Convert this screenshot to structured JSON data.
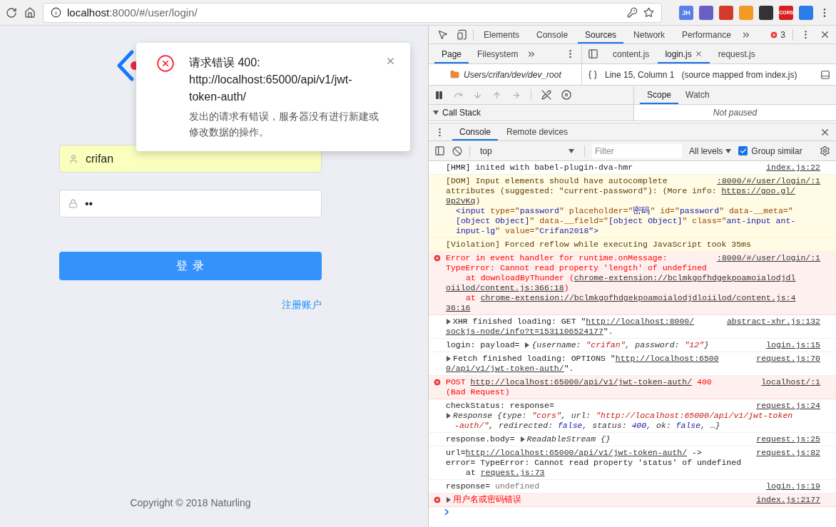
{
  "browser": {
    "address": {
      "host": "localhost",
      "path": ":8000/#/user/login/"
    },
    "extensions": [
      {
        "label": "JH",
        "color": "#5a7fe8"
      },
      {
        "color": "#6b5fc4"
      },
      {
        "color": "#d23a2c"
      },
      {
        "color": "#f39a26"
      },
      {
        "color": "#333333"
      },
      {
        "label": "CORS",
        "color": "#d81e1e"
      },
      {
        "color": "#2b7de9"
      }
    ]
  },
  "login_page": {
    "username": {
      "value": "crifan",
      "autofilled": true
    },
    "password": {
      "value": "••",
      "autofilled": false
    },
    "submit": "登 录",
    "register_link": "注册账户",
    "copyright": "Copyright © 2018 Naturling"
  },
  "notification": {
    "kind": "error",
    "title": "请求错误 400: http://localhost:65000/api/v1/jwt-token-auth/",
    "description": "发出的请求有错误，服务器没有进行新建或修改数据的操作。"
  },
  "devtools": {
    "tabs": [
      {
        "label": "Elements",
        "selected": false
      },
      {
        "label": "Console",
        "selected": false
      },
      {
        "label": "Sources",
        "selected": true
      },
      {
        "label": "Network",
        "selected": false
      },
      {
        "label": "Performance",
        "selected": false
      }
    ],
    "error_count": "3",
    "navigator": {
      "tabs": [
        {
          "label": "Page",
          "selected": true
        },
        {
          "label": "Filesystem",
          "selected": false
        }
      ],
      "tree_item": "Users/crifan/dev/dev_root"
    },
    "editor_tabs": [
      {
        "label": "content.js",
        "selected": false,
        "closable": false
      },
      {
        "label": "login.js",
        "selected": true,
        "closable": true
      },
      {
        "label": "request.js",
        "selected": false,
        "closable": false
      }
    ],
    "status": {
      "position": "Line 15, Column 1",
      "source_map": "(source mapped from index.js)"
    },
    "call_stack": {
      "label": "Call Stack",
      "expanded": true
    },
    "sidebar_tabs": [
      {
        "label": "Scope",
        "selected": true
      },
      {
        "label": "Watch",
        "selected": false
      }
    ],
    "sidebar_message": "Not paused",
    "drawer_tabs": [
      {
        "label": "Console",
        "selected": true
      },
      {
        "label": "Remote devices",
        "selected": false
      }
    ],
    "console_toolbar": {
      "context": "top",
      "filter_placeholder": "Filter",
      "levels": "All levels",
      "group_similar": {
        "label": "Group similar",
        "checked": true
      }
    },
    "messages": [
      {
        "kind": "info",
        "source": "index.js:22",
        "lines": [
          {
            "kind": "plain",
            "segs": [
              {
                "kind": "plain",
                "text": "[HMR] inited with babel-plugin-dva-hmr"
              }
            ]
          }
        ]
      },
      {
        "kind": "warning",
        "source": ":8000/#/user/login/:1",
        "lines": [
          {
            "kind": "plain",
            "segs": [
              {
                "kind": "plain",
                "text": "[DOM] Input elements should have autocomplete"
              }
            ]
          },
          {
            "kind": "plain",
            "segs": [
              {
                "kind": "plain",
                "text": "attributes (suggested: \"current-password\"): (More info: "
              },
              {
                "kind": "link",
                "text": "https://goo.gl/"
              }
            ]
          },
          {
            "kind": "plain",
            "segs": [
              {
                "kind": "link",
                "text": "9p2vKq"
              },
              {
                "kind": "plain",
                "text": ")"
              }
            ]
          },
          {
            "kind": "node",
            "segs": [
              {
                "kind": "tag",
                "text": "<input "
              },
              {
                "kind": "attr",
                "text": "type=\""
              },
              {
                "kind": "value",
                "text": "password"
              },
              {
                "kind": "attr",
                "text": "\" placeholder=\""
              },
              {
                "kind": "value",
                "text": "密码"
              },
              {
                "kind": "attr",
                "text": "\" id=\""
              },
              {
                "kind": "value",
                "text": "password"
              },
              {
                "kind": "attr",
                "text": "\" data-__meta=\""
              }
            ]
          },
          {
            "kind": "node",
            "segs": [
              {
                "kind": "value",
                "text": "[object Object]"
              },
              {
                "kind": "attr",
                "text": "\" data-__field=\""
              },
              {
                "kind": "value",
                "text": "[object Object]"
              },
              {
                "kind": "attr",
                "text": "\" class=\""
              },
              {
                "kind": "value",
                "text": "ant-input ant-"
              }
            ]
          },
          {
            "kind": "node",
            "segs": [
              {
                "kind": "value",
                "text": "input-lg"
              },
              {
                "kind": "attr",
                "text": "\" value=\""
              },
              {
                "kind": "value",
                "text": "Crifan2018"
              },
              {
                "kind": "tag",
                "text": "\">"
              }
            ]
          }
        ]
      },
      {
        "kind": "warning",
        "lines": [
          {
            "kind": "plain",
            "segs": [
              {
                "kind": "plain",
                "text": "[Violation] Forced reflow while executing JavaScript took 35ms"
              }
            ]
          }
        ]
      },
      {
        "kind": "error",
        "source": ":8000/#/user/login/:1",
        "lines": [
          {
            "kind": "plain",
            "segs": [
              {
                "kind": "plain",
                "text": "Error in event handler for runtime.onMessage:"
              }
            ]
          },
          {
            "kind": "plain",
            "segs": [
              {
                "kind": "plain",
                "text": "TypeError: Cannot read property 'length' of undefined"
              }
            ]
          },
          {
            "kind": "stack",
            "segs": [
              {
                "kind": "plain",
                "text": "at downloadByThunder ("
              },
              {
                "kind": "link",
                "text": "chrome-extension://bclmkgofhdgekpoamoialodjdl"
              }
            ]
          },
          {
            "kind": "plain",
            "segs": [
              {
                "kind": "link",
                "text": "oiilod/content.js:366:18"
              },
              {
                "kind": "plain",
                "text": ")"
              }
            ]
          },
          {
            "kind": "stack",
            "segs": [
              {
                "kind": "plain",
                "text": "at "
              },
              {
                "kind": "link",
                "text": "chrome-extension://bclmkgofhdgekpoamoialodjdloiilod/content.js:4"
              }
            ]
          },
          {
            "kind": "plain",
            "segs": [
              {
                "kind": "link",
                "text": "36:16"
              }
            ]
          }
        ]
      },
      {
        "kind": "info",
        "source": "abstract-xhr.js:132",
        "lines": [
          {
            "kind": "plain",
            "segs": [
              {
                "kind": "toggle"
              },
              {
                "kind": "plain",
                "text": "XHR finished loading: GET \""
              },
              {
                "kind": "link",
                "text": "http://localhost:8000/"
              }
            ]
          },
          {
            "kind": "plain",
            "segs": [
              {
                "kind": "link",
                "text": "sockjs-node/info?t=1531106524177"
              },
              {
                "kind": "plain",
                "text": "\"."
              }
            ]
          }
        ]
      },
      {
        "kind": "info",
        "source": "login.js:15",
        "lines": [
          {
            "kind": "plain",
            "segs": [
              {
                "kind": "plain",
                "text": "login: payload= "
              },
              {
                "kind": "toggle"
              },
              {
                "kind": "italic",
                "text": "{username: "
              },
              {
                "kind": "string",
                "text": "\"crifan\""
              },
              {
                "kind": "italic",
                "text": ", password: "
              },
              {
                "kind": "string",
                "text": "\"12\""
              },
              {
                "kind": "italic",
                "text": "}"
              }
            ]
          }
        ]
      },
      {
        "kind": "info",
        "source": "request.js:70",
        "lines": [
          {
            "kind": "plain",
            "segs": [
              {
                "kind": "toggle"
              },
              {
                "kind": "plain",
                "text": "Fetch finished loading: OPTIONS \""
              },
              {
                "kind": "link",
                "text": "http://localhost:6500"
              }
            ]
          },
          {
            "kind": "plain",
            "segs": [
              {
                "kind": "link",
                "text": "0/api/v1/jwt-token-auth/"
              },
              {
                "kind": "plain",
                "text": "\"."
              }
            ]
          }
        ]
      },
      {
        "kind": "error",
        "source": "localhost/:1",
        "lines": [
          {
            "kind": "plain",
            "segs": [
              {
                "kind": "plain",
                "text": "POST "
              },
              {
                "kind": "link",
                "text": "http://localhost:65000/api/v1/jwt-token-auth/"
              },
              {
                "kind": "plain",
                "text": " 400"
              }
            ]
          },
          {
            "kind": "plain",
            "segs": [
              {
                "kind": "plain",
                "text": "(Bad Request)"
              }
            ]
          }
        ]
      },
      {
        "kind": "info",
        "source": "request.js:24",
        "lines": [
          {
            "kind": "plain",
            "segs": [
              {
                "kind": "plain",
                "text": "checkStatus: response="
              }
            ]
          },
          {
            "kind": "plain",
            "segs": [
              {
                "kind": "toggle"
              },
              {
                "kind": "italic",
                "text": "Response {type: "
              },
              {
                "kind": "string",
                "text": "\"cors\""
              },
              {
                "kind": "italic",
                "text": ", url: "
              },
              {
                "kind": "string",
                "text": "\"http://localhost:65000/api/v1/jwt-token"
              }
            ]
          },
          {
            "kind": "object",
            "segs": [
              {
                "kind": "string",
                "text": "-auth/\""
              },
              {
                "kind": "italic",
                "text": ", redirected: "
              },
              {
                "kind": "keyword",
                "text": "false"
              },
              {
                "kind": "italic",
                "text": ", status: "
              },
              {
                "kind": "keyword",
                "text": "400"
              },
              {
                "kind": "italic",
                "text": ", ok: "
              },
              {
                "kind": "keyword",
                "text": "false"
              },
              {
                "kind": "italic",
                "text": ", …}"
              }
            ]
          }
        ]
      },
      {
        "kind": "info",
        "source": "request.js:25",
        "lines": [
          {
            "kind": "plain",
            "segs": [
              {
                "kind": "plain",
                "text": "response.body= "
              },
              {
                "kind": "toggle"
              },
              {
                "kind": "italic",
                "text": "ReadableStream {}"
              }
            ]
          }
        ]
      },
      {
        "kind": "info",
        "source": "request.js:82",
        "lines": [
          {
            "kind": "plain",
            "segs": [
              {
                "kind": "plain",
                "text": "url="
              },
              {
                "kind": "link",
                "text": "http://localhost:65000/api/v1/jwt-token-auth/"
              },
              {
                "kind": "plain",
                "text": " ->"
              }
            ]
          },
          {
            "kind": "plain",
            "segs": [
              {
                "kind": "plain",
                "text": "error= TypeError: Cannot read property 'status' of undefined"
              }
            ]
          },
          {
            "kind": "stack",
            "segs": [
              {
                "kind": "plain",
                "text": "at "
              },
              {
                "kind": "link",
                "text": "request.js:73"
              }
            ]
          }
        ]
      },
      {
        "kind": "info",
        "source": "login.js:19",
        "lines": [
          {
            "kind": "plain",
            "segs": [
              {
                "kind": "plain",
                "text": "response= "
              },
              {
                "kind": "dim",
                "text": "undefined"
              }
            ]
          }
        ]
      },
      {
        "kind": "error",
        "source": "index.js:2177",
        "lines": [
          {
            "kind": "plain",
            "segs": [
              {
                "kind": "toggle"
              },
              {
                "kind": "plain",
                "text": "用户名或密码错误"
              }
            ]
          }
        ]
      }
    ]
  }
}
